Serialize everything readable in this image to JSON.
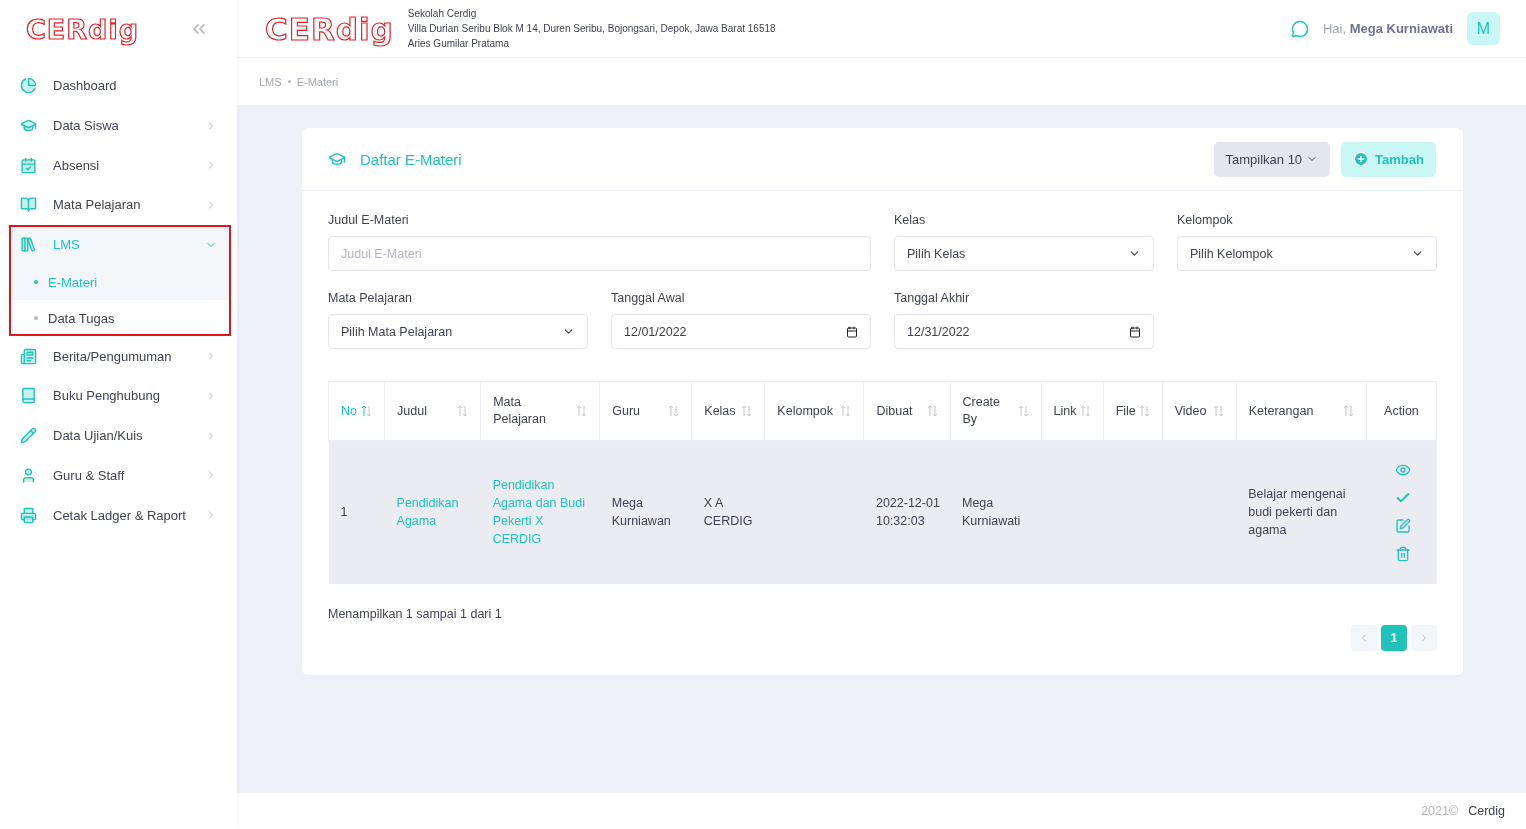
{
  "sidebar": {
    "logo": "CERdig",
    "items": [
      {
        "label": "Dashboard",
        "kind": "link",
        "selected": false,
        "highlighted": false
      },
      {
        "label": "Data Siswa",
        "kind": "menu",
        "selected": false,
        "expanded": false,
        "highlighted": false
      },
      {
        "label": "Absensi",
        "kind": "menu",
        "selected": false,
        "expanded": false,
        "highlighted": false
      },
      {
        "label": "Mata Pelajaran",
        "kind": "menu",
        "selected": false,
        "expanded": false,
        "highlighted": false
      },
      {
        "label": "LMS",
        "kind": "menu",
        "selected": true,
        "expanded": true,
        "highlighted": true,
        "children": [
          {
            "label": "E-Materi",
            "selected": true
          },
          {
            "label": "Data Tugas",
            "selected": false
          }
        ]
      },
      {
        "label": "Berita/Pengumuman",
        "kind": "menu",
        "selected": false,
        "expanded": false,
        "highlighted": false
      },
      {
        "label": "Buku Penghubung",
        "kind": "menu",
        "selected": false,
        "expanded": false,
        "highlighted": false
      },
      {
        "label": "Data Ujian/Kuis",
        "kind": "menu",
        "selected": false,
        "expanded": false,
        "highlighted": false
      },
      {
        "label": "Guru & Staff",
        "kind": "menu",
        "selected": false,
        "expanded": false,
        "highlighted": false
      },
      {
        "label": "Cetak Ladger & Raport",
        "kind": "menu",
        "selected": false,
        "expanded": false,
        "highlighted": false
      }
    ]
  },
  "header": {
    "logo": "CERdig",
    "school": "Sekolah Cerdig",
    "address": "Villa Durian Seribu Blok M 14, Duren Seribu, Bojongsari, Depok, Jawa Barat 16518",
    "principal": "Aries Gumilar Pratama",
    "greeting": "Hai, **Mega Kurniawati**",
    "avatar": "M"
  },
  "breadcrumb": [
    "LMS",
    "E-Materi"
  ],
  "card": {
    "title": "Daftar E-Materi",
    "page_size_button": "Tampilkan 10",
    "add_button": "Tambah",
    "filters": [
      {
        "label": "Judul E-Materi",
        "kind": "text",
        "placeholder": "Judul E-Materi"
      },
      {
        "label": "Kelas",
        "kind": "select",
        "value": "Pilih Kelas"
      },
      {
        "label": "Kelompok",
        "kind": "select",
        "value": "Pilih Kelompok"
      },
      {
        "label": "Mata Pelajaran",
        "kind": "select",
        "value": "Pilih Mata Pelajaran"
      },
      {
        "label": "Tanggal Awal",
        "kind": "date",
        "value": "12/01/2022"
      },
      {
        "label": "Tanggal Akhir",
        "kind": "date",
        "value": "12/31/2022"
      }
    ],
    "table": {
      "columns": [
        {
          "label": "No",
          "sortable": true,
          "sorted": true
        },
        {
          "label": "Judul",
          "sortable": true,
          "sorted": false
        },
        {
          "label": "Mata Pelajaran",
          "sortable": true,
          "sorted": false
        },
        {
          "label": "Guru",
          "sortable": true,
          "sorted": false
        },
        {
          "label": "Kelas",
          "sortable": true,
          "sorted": false
        },
        {
          "label": "Kelompok",
          "sortable": true,
          "sorted": false
        },
        {
          "label": "Dibuat",
          "sortable": true,
          "sorted": false
        },
        {
          "label": "Create By",
          "sortable": true,
          "sorted": false
        },
        {
          "label": "Link",
          "sortable": true,
          "sorted": false
        },
        {
          "label": "File",
          "sortable": true,
          "sorted": false
        },
        {
          "label": "Video",
          "sortable": true,
          "sorted": false
        },
        {
          "label": "Keterangan",
          "sortable": true,
          "sorted": false
        },
        {
          "label": "Action",
          "sortable": false,
          "sorted": false
        }
      ],
      "rows": [
        {
          "highlighted": true,
          "cells": [
            {
              "text": "1",
              "kind": "plain"
            },
            {
              "text": "Pendidikan Agama",
              "kind": "link"
            },
            {
              "text": "Pendidikan Agama dan Budi Pekerti X CERDIG",
              "kind": "link"
            },
            {
              "text": "Mega Kurniawan",
              "kind": "plain"
            },
            {
              "text": "X A CERDIG",
              "kind": "plain"
            },
            {
              "kind": "empty"
            },
            {
              "text": "2022-12-01 10:32:03",
              "kind": "plain"
            },
            {
              "text": "Mega Kurniawati",
              "kind": "plain"
            },
            {
              "kind": "empty"
            },
            {
              "kind": "empty"
            },
            {
              "kind": "empty"
            },
            {
              "text": "Belajar mengenai budi pekerti dan agama",
              "kind": "plain"
            },
            {
              "kind": "actions"
            }
          ]
        }
      ]
    },
    "summary": "Menampilkan 1 sampai 1 dari 1",
    "pages": [
      {
        "label": "1",
        "selected": true
      }
    ]
  },
  "footer": {
    "year": "2021©",
    "brand": "Cerdig"
  }
}
